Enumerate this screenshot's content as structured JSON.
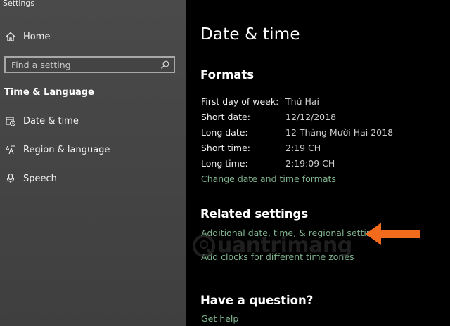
{
  "app": {
    "title": "Settings"
  },
  "sidebar": {
    "home_label": "Home",
    "search_placeholder": "Find a setting",
    "section_heading": "Time & Language",
    "items": [
      {
        "label": "Date & time",
        "icon": "calendar-clock-icon"
      },
      {
        "label": "Region & language",
        "icon": "region-language-icon"
      },
      {
        "label": "Speech",
        "icon": "microphone-icon"
      }
    ]
  },
  "main": {
    "title": "Date & time",
    "formats": {
      "heading": "Formats",
      "rows": [
        {
          "label": "First day of week:",
          "value": "Thứ Hai"
        },
        {
          "label": "Short date:",
          "value": "12/12/2018"
        },
        {
          "label": "Long date:",
          "value": "12 Tháng Mười Hai 2018"
        },
        {
          "label": "Short time:",
          "value": "2:19 CH"
        },
        {
          "label": "Long time:",
          "value": "2:19:09 CH"
        }
      ],
      "change_link": "Change date and time formats"
    },
    "related": {
      "heading": "Related settings",
      "additional_link": "Additional date, time, & regional settings",
      "clocks_link": "Add clocks for different time zones"
    },
    "question": {
      "heading": "Have a question?",
      "help_link": "Get help"
    }
  },
  "watermark": {
    "text": "uantrimang"
  },
  "colors": {
    "sidebar_bg": "#464646",
    "main_bg": "#000000",
    "link": "#7fb48f",
    "arrow": "#f26b1d"
  }
}
